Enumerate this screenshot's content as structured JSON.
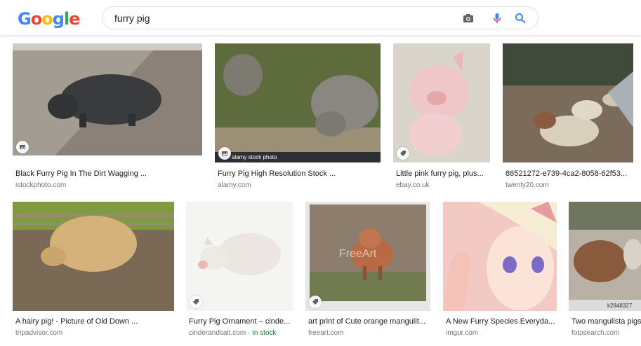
{
  "logo": {
    "letters": [
      "G",
      "o",
      "o",
      "g",
      "l",
      "e"
    ],
    "colors": [
      "#4285f4",
      "#ea4335",
      "#fbbc05",
      "#4285f4",
      "#34a853",
      "#ea4335"
    ]
  },
  "search": {
    "query": "furry pig",
    "camera_icon": "camera-icon",
    "mic_icon": "microphone-icon",
    "search_icon": "search-icon"
  },
  "results": [
    {
      "title": "Black Furry Pig In The Dirt Wagging ...",
      "source": "istockphoto.com",
      "badge": "image-icon"
    },
    {
      "title": "Furry Pig High Resolution Stock ...",
      "source": "alamy.com",
      "badge": "image-icon",
      "watermark": "alamy stock photo"
    },
    {
      "title": "Little pink furry pig, plus...",
      "source": "ebay.co.uk",
      "badge": "tag-icon"
    },
    {
      "title": "86521272-e739-4ca2-8058-62f53...",
      "source": "twenty20.com"
    },
    {
      "title": "A hairy pig! - Picture of Old Down ...",
      "source": "tripadvisor.com"
    },
    {
      "title": "Furry Pig Ornament – cinde...",
      "source": "cinderandsalt.com",
      "stock": " · In stock",
      "badge": "tag-icon"
    },
    {
      "title": "art print of Cute orange mangulit...",
      "source": "freeart.com",
      "badge": "tag-icon",
      "watermark": "FreeArt"
    },
    {
      "title": "A New Furry Species Everyda...",
      "source": "imgur.com"
    },
    {
      "title": "Two mangulista pigs",
      "source": "fotosearch.com",
      "watermark": "k2848327"
    }
  ]
}
